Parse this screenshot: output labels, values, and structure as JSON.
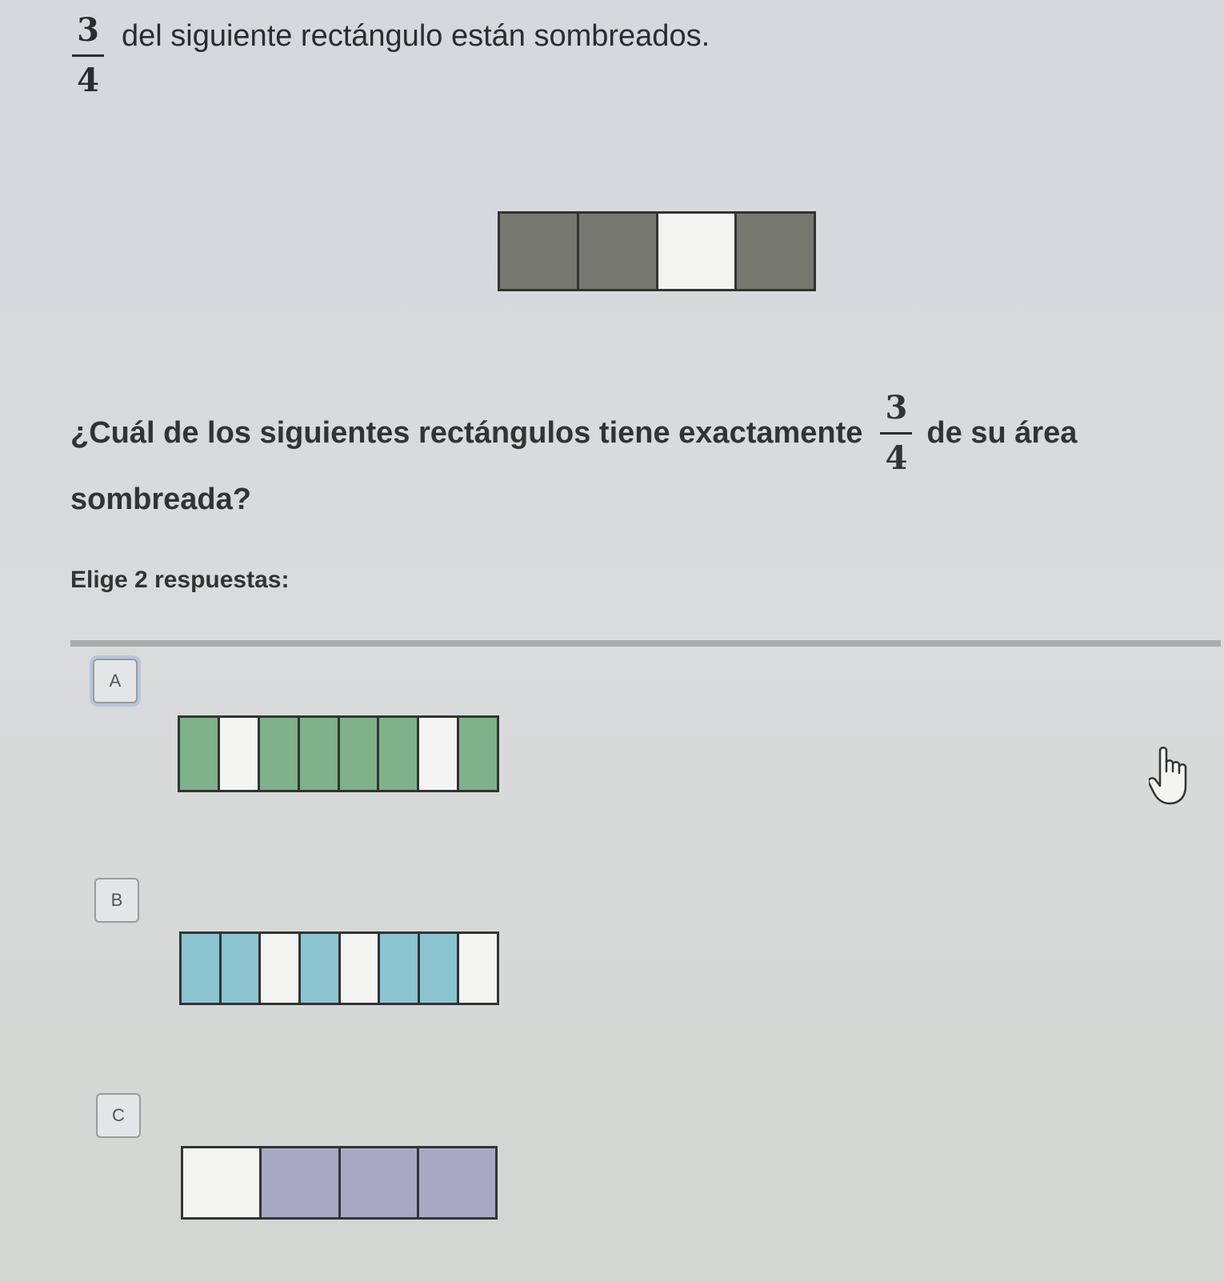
{
  "intro": {
    "numerator": "3",
    "denominator": "4",
    "text": "del siguiente rectángulo están sombreados."
  },
  "given_rectangle": {
    "cells": [
      "shaded",
      "shaded",
      "empty",
      "shaded"
    ],
    "shaded_color": "#77786f"
  },
  "question": {
    "text_before": "¿Cuál de los siguientes rectángulos tiene exactamente",
    "numerator": "3",
    "denominator": "4",
    "text_after": "de su área",
    "text_line2": "sombreada?"
  },
  "instruction": "Elige 2 respuestas:",
  "choices": [
    {
      "letter": "A",
      "color": "#7fb18a",
      "cells": [
        "shaded",
        "empty",
        "shaded",
        "shaded",
        "shaded",
        "shaded",
        "empty",
        "shaded"
      ]
    },
    {
      "letter": "B",
      "color": "#8cc4d2",
      "cells": [
        "shaded",
        "shaded",
        "empty",
        "shaded",
        "empty",
        "shaded",
        "shaded",
        "empty"
      ]
    },
    {
      "letter": "C",
      "color": "#a9a8c4",
      "cells": [
        "empty",
        "shaded",
        "shaded",
        "shaded"
      ]
    }
  ],
  "cursor_icon": "hand-pointer-icon"
}
